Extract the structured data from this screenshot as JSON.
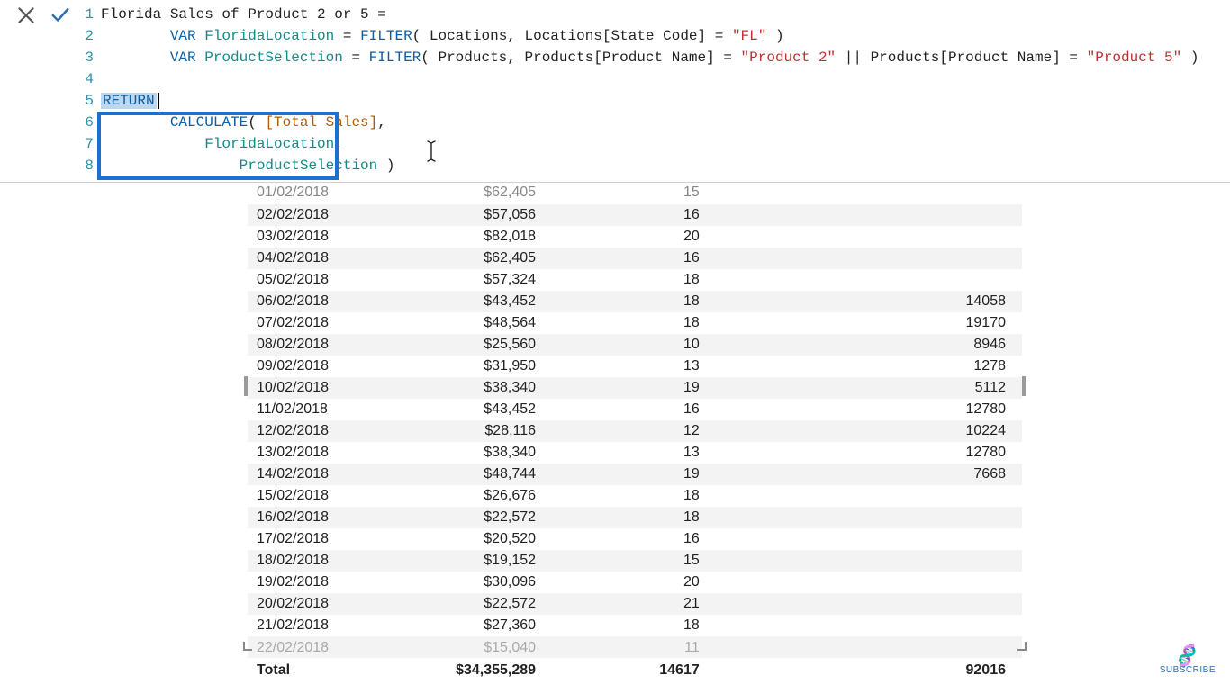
{
  "formula": {
    "lines": {
      "1": {
        "n": "1",
        "a": "Florida Sales of Product 2 or 5 ="
      },
      "2": {
        "n": "2",
        "kw1": "VAR ",
        "id": "FloridaLocation",
        "eq": " = ",
        "fn": "FILTER",
        "open": "( ",
        "arg1": "Locations, Locations[State Code] = ",
        "str": "\"FL\"",
        "close": " )"
      },
      "3": {
        "n": "3",
        "kw1": "VAR ",
        "id": "ProductSelection",
        "eq": " = ",
        "fn": "FILTER",
        "open": "( ",
        "arg1": "Products, Products[Product Name] = ",
        "str1": "\"Product 2\"",
        "or": " || ",
        "arg2": "Products[Product Name] = ",
        "str2": "\"Product 5\"",
        "close": " )"
      },
      "4": {
        "n": "4"
      },
      "5": {
        "n": "5",
        "ret": "RETURN"
      },
      "6": {
        "n": "6",
        "fn": "CALCULATE",
        "open": "( ",
        "meas": "[Total Sales]",
        "close": ","
      },
      "7": {
        "n": "7",
        "indent": "    ",
        "id": "FloridaLocation",
        "close": ","
      },
      "8": {
        "n": "8",
        "indent": "        ",
        "id": "ProductSelection",
        "close": " )"
      }
    }
  },
  "table": {
    "rows": [
      {
        "date": "01/02/2018",
        "sales": "$62,405",
        "q": "15",
        "v": ""
      },
      {
        "date": "02/02/2018",
        "sales": "$57,056",
        "q": "16",
        "v": ""
      },
      {
        "date": "03/02/2018",
        "sales": "$82,018",
        "q": "20",
        "v": ""
      },
      {
        "date": "04/02/2018",
        "sales": "$62,405",
        "q": "16",
        "v": ""
      },
      {
        "date": "05/02/2018",
        "sales": "$57,324",
        "q": "18",
        "v": ""
      },
      {
        "date": "06/02/2018",
        "sales": "$43,452",
        "q": "18",
        "v": "14058"
      },
      {
        "date": "07/02/2018",
        "sales": "$48,564",
        "q": "18",
        "v": "19170"
      },
      {
        "date": "08/02/2018",
        "sales": "$25,560",
        "q": "10",
        "v": "8946"
      },
      {
        "date": "09/02/2018",
        "sales": "$31,950",
        "q": "13",
        "v": "1278"
      },
      {
        "date": "10/02/2018",
        "sales": "$38,340",
        "q": "19",
        "v": "5112"
      },
      {
        "date": "11/02/2018",
        "sales": "$43,452",
        "q": "16",
        "v": "12780"
      },
      {
        "date": "12/02/2018",
        "sales": "$28,116",
        "q": "12",
        "v": "10224"
      },
      {
        "date": "13/02/2018",
        "sales": "$38,340",
        "q": "13",
        "v": "12780"
      },
      {
        "date": "14/02/2018",
        "sales": "$48,744",
        "q": "19",
        "v": "7668"
      },
      {
        "date": "15/02/2018",
        "sales": "$26,676",
        "q": "18",
        "v": ""
      },
      {
        "date": "16/02/2018",
        "sales": "$22,572",
        "q": "18",
        "v": ""
      },
      {
        "date": "17/02/2018",
        "sales": "$20,520",
        "q": "16",
        "v": ""
      },
      {
        "date": "18/02/2018",
        "sales": "$19,152",
        "q": "15",
        "v": ""
      },
      {
        "date": "19/02/2018",
        "sales": "$30,096",
        "q": "20",
        "v": ""
      },
      {
        "date": "20/02/2018",
        "sales": "$22,572",
        "q": "21",
        "v": ""
      },
      {
        "date": "21/02/2018",
        "sales": "$27,360",
        "q": "18",
        "v": ""
      }
    ],
    "clipped_bottom": {
      "date": "22/02/2018",
      "sales": "$15,040",
      "q": "11",
      "v": ""
    },
    "total": {
      "label": "Total",
      "sales": "$34,355,289",
      "q": "14617",
      "v": "92016"
    }
  },
  "badge": {
    "text": "SUBSCRIBE"
  }
}
